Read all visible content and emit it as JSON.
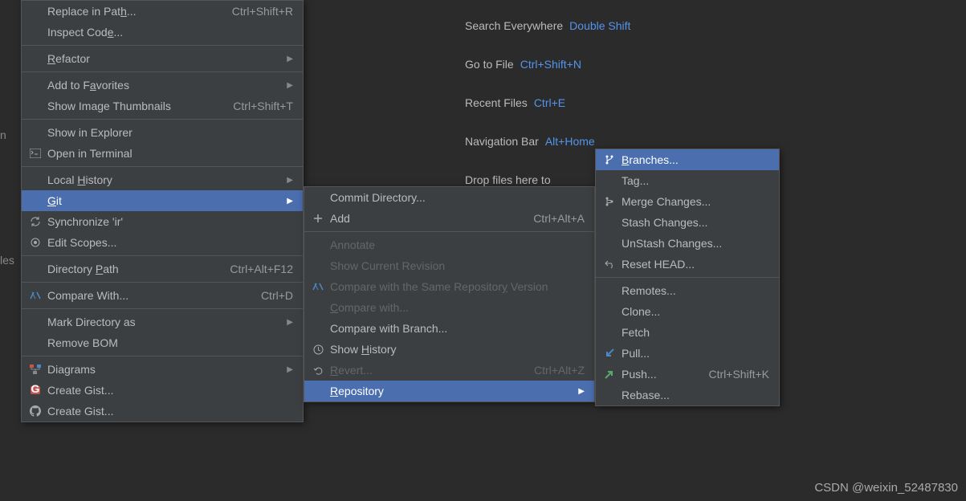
{
  "hints": [
    {
      "label": "Search Everywhere",
      "shortcut": "Double Shift"
    },
    {
      "label": "Go to File",
      "shortcut": "Ctrl+Shift+N"
    },
    {
      "label": "Recent Files",
      "shortcut": "Ctrl+E"
    },
    {
      "label": "Navigation Bar",
      "shortcut": "Alt+Home"
    },
    {
      "label": "Drop files here to",
      "shortcut": ""
    }
  ],
  "menu1": {
    "items": [
      {
        "label_pre": "Replace in Pat",
        "und": "h",
        "label_post": "...",
        "shortcut": "Ctrl+Shift+R"
      },
      {
        "label_pre": "Inspect Cod",
        "und": "e",
        "label_post": "..."
      },
      "sep",
      {
        "und": "R",
        "label_post": "efactor",
        "arrow": true
      },
      "sep",
      {
        "label_pre": "Add to F",
        "und": "a",
        "label_post": "vorites",
        "arrow": true
      },
      {
        "label_pre": "Show Image Thumbnails",
        "shortcut": "Ctrl+Shift+T"
      },
      "sep",
      {
        "label_pre": "Show in Explorer"
      },
      {
        "label_pre": "Open in Terminal",
        "icon": "terminal"
      },
      "sep",
      {
        "label_pre": "Local ",
        "und": "H",
        "label_post": "istory",
        "arrow": true
      },
      {
        "und": "G",
        "label_post": "it",
        "arrow": true,
        "highlight": true
      },
      {
        "label_pre": "Synchronize 'ir'",
        "icon": "sync"
      },
      {
        "label_pre": "Edit Scopes...",
        "icon": "scope"
      },
      "sep",
      {
        "label_pre": "Directory ",
        "und": "P",
        "label_post": "ath",
        "shortcut": "Ctrl+Alt+F12"
      },
      "sep",
      {
        "label_pre": "Compare With...",
        "icon": "compare",
        "shortcut": "Ctrl+D"
      },
      "sep",
      {
        "label_pre": "Mark Directory as",
        "arrow": true
      },
      {
        "label_pre": "Remove BOM"
      },
      "sep",
      {
        "label_pre": "Diagrams",
        "icon": "diagram",
        "arrow": true
      },
      {
        "label_pre": "Create Gist...",
        "icon": "gist-red"
      },
      {
        "label_pre": "Create Gist...",
        "icon": "github"
      }
    ]
  },
  "menu2": {
    "items": [
      {
        "label_pre": "Commit Directory..."
      },
      {
        "label_pre": "Add",
        "icon": "plus",
        "shortcut": "Ctrl+Alt+A"
      },
      "sep",
      {
        "label_pre": "Annotate",
        "disabled": true
      },
      {
        "label_pre": "Show Current Revision",
        "disabled": true
      },
      {
        "label_pre": "Compare with the Same Repositor",
        "und": "y",
        "label_post": " Version",
        "icon": "compare",
        "disabled": true
      },
      {
        "und": "C",
        "label_post": "ompare with...",
        "disabled": true
      },
      {
        "label_pre": "Compare with Branch..."
      },
      {
        "label_pre": "Show ",
        "und": "H",
        "label_post": "istory",
        "icon": "clock"
      },
      {
        "und": "R",
        "label_post": "evert...",
        "icon": "revert",
        "shortcut": "Ctrl+Alt+Z",
        "disabled": true
      },
      {
        "und": "R",
        "label_post": "epository",
        "arrow": true,
        "highlight": true
      }
    ]
  },
  "menu3": {
    "items": [
      {
        "und": "B",
        "label_post": "ranches...",
        "icon": "branch",
        "highlight": true
      },
      {
        "label_pre": "Tag..."
      },
      {
        "label_pre": "Merge Changes...",
        "icon": "merge"
      },
      {
        "label_pre": "Stash Changes..."
      },
      {
        "label_pre": "UnStash Changes..."
      },
      {
        "label_pre": "Reset HEAD...",
        "icon": "reset"
      },
      "sep",
      {
        "label_pre": "Remotes..."
      },
      {
        "label_pre": "Clone..."
      },
      {
        "label_pre": "Fetch"
      },
      {
        "label_pre": "Pull...",
        "icon": "pull"
      },
      {
        "label_pre": "Push...",
        "icon": "push",
        "shortcut": "Ctrl+Shift+K"
      },
      {
        "label_pre": "Rebase..."
      }
    ]
  },
  "watermark": "CSDN @weixin_52487830",
  "leftedge": [
    "n",
    "les"
  ]
}
